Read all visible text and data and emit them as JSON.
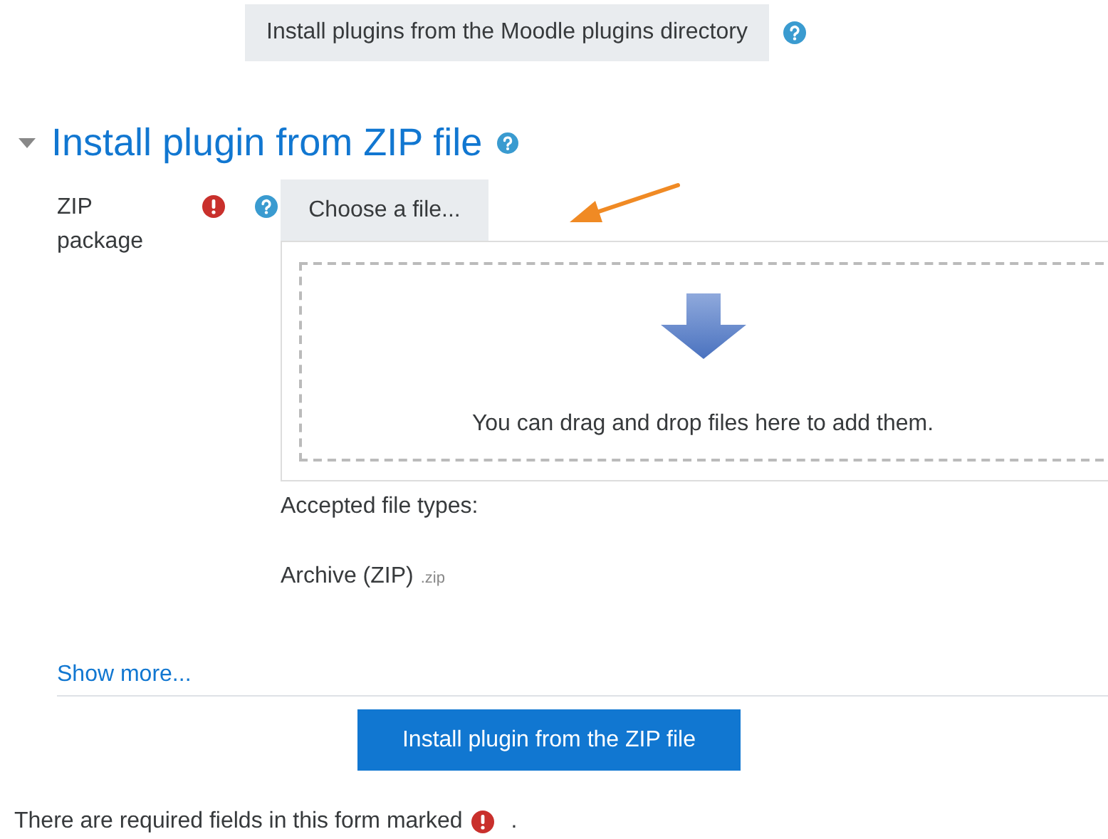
{
  "directory_button": {
    "label": "Install plugins from the Moodle plugins directory"
  },
  "section": {
    "title": "Install plugin from ZIP file",
    "expanded": true
  },
  "field": {
    "label": "ZIP package",
    "required": true,
    "choose_button": "Choose a file...",
    "dropzone_text": "You can drag and drop files here to add them.",
    "accepted_label": "Accepted file types:",
    "accepted_type": "Archive (ZIP)",
    "accepted_ext": ".zip"
  },
  "show_more": "Show more...",
  "submit_button": "Install plugin from the ZIP file",
  "footer": {
    "before": "There are required fields in this form marked",
    "after": "."
  }
}
